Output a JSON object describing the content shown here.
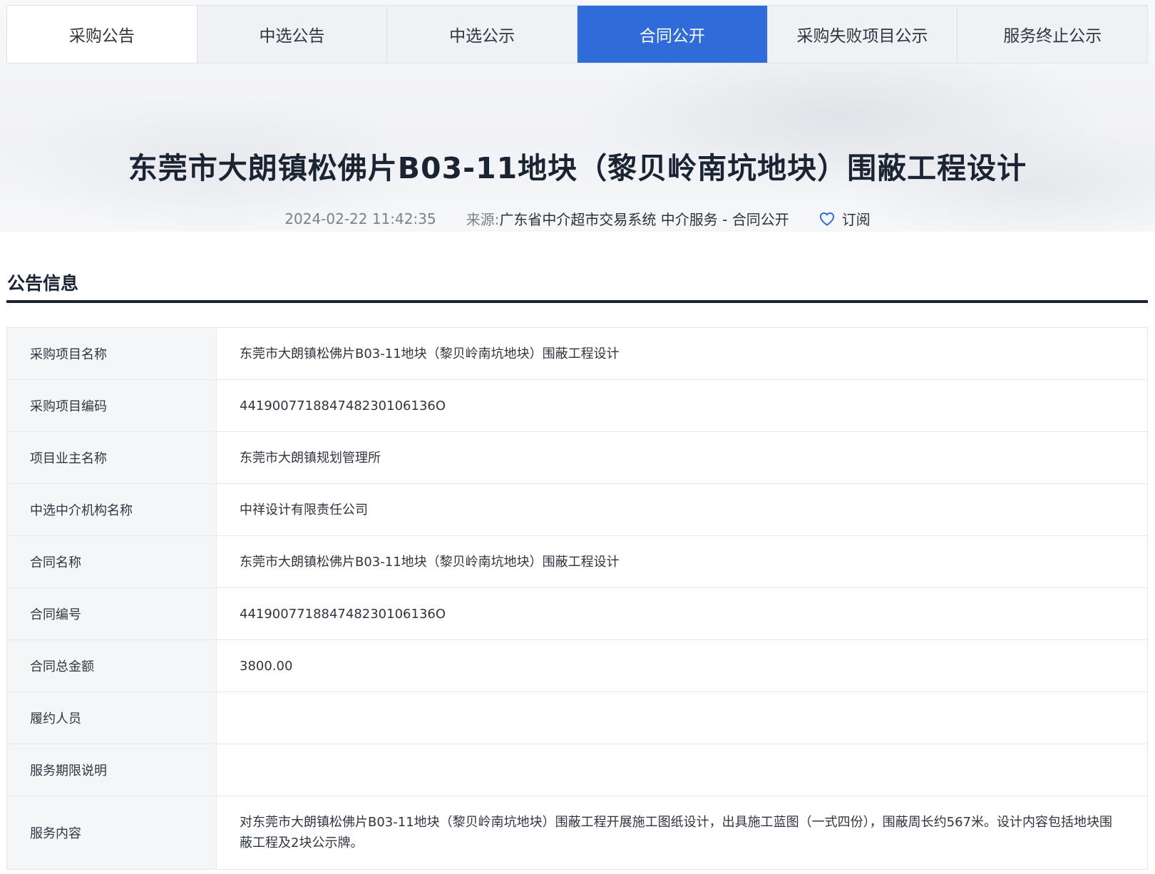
{
  "tabs": [
    {
      "label": "采购公告"
    },
    {
      "label": "中选公告"
    },
    {
      "label": "中选公示"
    },
    {
      "label": "合同公开"
    },
    {
      "label": "采购失败项目公示"
    },
    {
      "label": "服务终止公示"
    }
  ],
  "active_tab": "合同公开",
  "header": {
    "title": "东莞市大朗镇松佛片B03-11地块（黎贝岭南坑地块）围蔽工程设计",
    "date": "2024-02-22 11:42:35",
    "source_label": "来源:",
    "source": "广东省中介超市交易系统 中介服务 - 合同公开",
    "subscribe_label": "订阅"
  },
  "section": {
    "title": "公告信息"
  },
  "info": [
    {
      "label": "采购项目名称",
      "value": "东莞市大朗镇松佛片B03-11地块（黎贝岭南坑地块）围蔽工程设计"
    },
    {
      "label": "采购项目编码",
      "value": "441900771884748230106136O"
    },
    {
      "label": "项目业主名称",
      "value": "东莞市大朗镇规划管理所"
    },
    {
      "label": "中选中介机构名称",
      "value": "中祥设计有限责任公司"
    },
    {
      "label": "合同名称",
      "value": "东莞市大朗镇松佛片B03-11地块（黎贝岭南坑地块）围蔽工程设计"
    },
    {
      "label": "合同编号",
      "value": "441900771884748230106136O"
    },
    {
      "label": "合同总金额",
      "value": "3800.00"
    },
    {
      "label": "履约人员",
      "value": ""
    },
    {
      "label": "服务期限说明",
      "value": ""
    },
    {
      "label": "服务内容",
      "value": "对东莞市大朗镇松佛片B03-11地块（黎贝岭南坑地块）围蔽工程开展施工图纸设计，出具施工蓝图（一式四份），围蔽周长约567米。设计内容包括地块围蔽工程及2块公示牌。"
    }
  ],
  "colors": {
    "active_tab": "#2f6bd9",
    "tab_bg": "#eff1f4",
    "label_bg": "#f5f6f8",
    "rule": "#1c2330"
  },
  "icons": {
    "subscribe": "heart-outline-icon"
  }
}
